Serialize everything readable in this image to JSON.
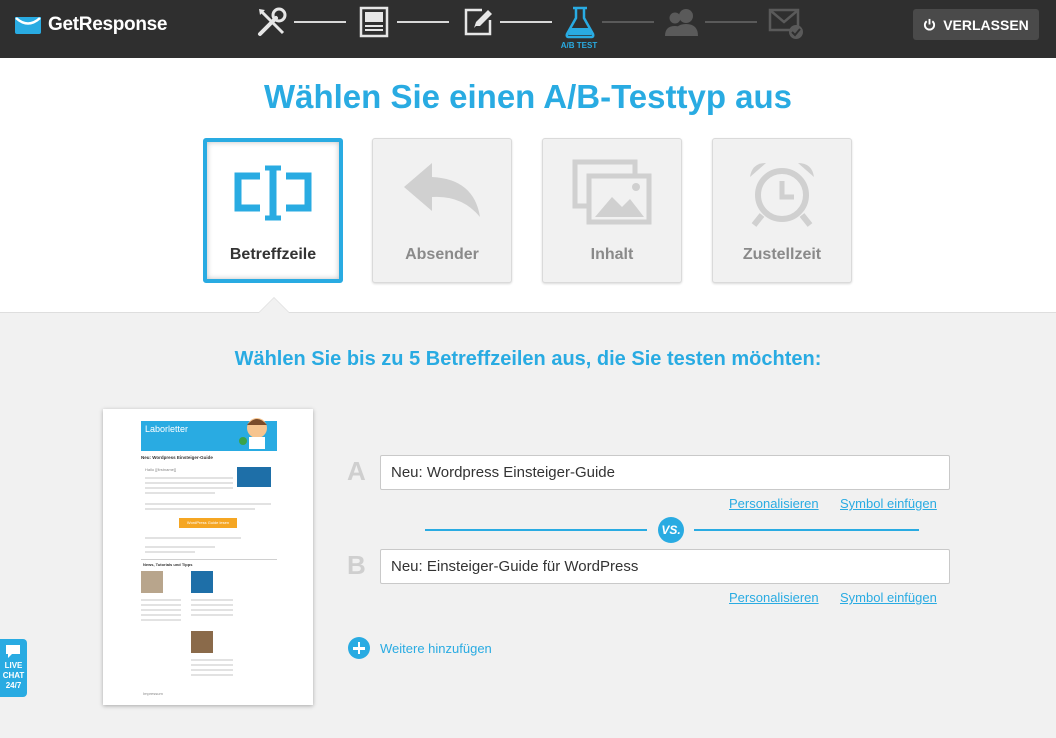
{
  "app": {
    "brand": "GetResponse"
  },
  "header": {
    "steps": [
      {
        "name": "settings",
        "icon": "tools-icon"
      },
      {
        "name": "template",
        "icon": "template-icon"
      },
      {
        "name": "editor",
        "icon": "edit-icon"
      },
      {
        "name": "ab-test",
        "icon": "flask-icon",
        "label": "A/B TEST",
        "active": true
      },
      {
        "name": "recipients",
        "icon": "users-icon"
      },
      {
        "name": "send",
        "icon": "mail-check-icon"
      }
    ],
    "exit_label": "VERLASSEN"
  },
  "test_type": {
    "title": "Wählen Sie einen A/B-Testtyp aus",
    "cards": [
      {
        "label": "Betreffzeile",
        "icon": "subject-line-icon",
        "selected": true
      },
      {
        "label": "Absender",
        "icon": "reply-icon",
        "selected": false
      },
      {
        "label": "Inhalt",
        "icon": "images-icon",
        "selected": false
      },
      {
        "label": "Zustellzeit",
        "icon": "alarm-clock-icon",
        "selected": false
      }
    ]
  },
  "subjects": {
    "title": "Wählen Sie bis zu 5 Betreffzeilen aus, die Sie testen möchten:",
    "variants": [
      {
        "letter": "A",
        "value": "Neu: Wordpress Einsteiger-Guide"
      },
      {
        "letter": "B",
        "value": "Neu: Einsteiger-Guide für WordPress"
      }
    ],
    "personalize_label": "Personalisieren",
    "insert_symbol_label": "Symbol einfügen",
    "vs_label": "VS.",
    "add_more_label": "Weitere hinzufügen"
  },
  "preview": {
    "banner_title": "Laborletter",
    "headline": "Neu: Wordpress Einsteiger-Guide",
    "greeting": "Hallo [[firstname]]",
    "cta": "WordPress Guide lesen",
    "section": "News, Tutorials und Tipps",
    "footer": "Impressum"
  },
  "livechat": {
    "line1": "LIVE",
    "line2": "CHAT",
    "line3": "24/7"
  },
  "colors": {
    "accent": "#29abe2",
    "topbar": "#2f2f2f"
  }
}
